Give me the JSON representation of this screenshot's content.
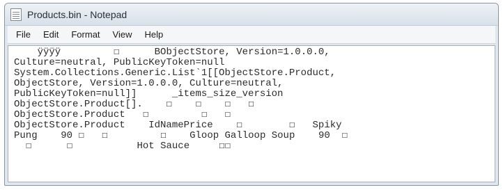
{
  "window": {
    "title": "Products.bin - Notepad"
  },
  "menu": {
    "file": "File",
    "edit": "Edit",
    "format": "Format",
    "view": "View",
    "help": "Help"
  },
  "content": {
    "lines": [
      "    ÿÿÿÿ         ☐      BObjectStore, Version=1.0.0.0,",
      "Culture=neutral, PublicKeyToken=null",
      "System.Collections.Generic.List`1[[ObjectStore.Product,",
      "ObjectStore, Version=1.0.0.0, Culture=neutral,",
      "PublicKeyToken=null]]      _items_size_version",
      "ObjectStore.Product[].    ☐    ☐    ☐   ☐",
      "ObjectStore.Product   ☐         ☐   ☐",
      "ObjectStore.Product    IdNamePrice    ☐        ☐   Spiky",
      "Pung    90 ☐   ☐         ☐    Gloop Galloop Soup    90  ☐",
      "  ☐      ☐           Hot Sauce     ☐☐"
    ]
  }
}
